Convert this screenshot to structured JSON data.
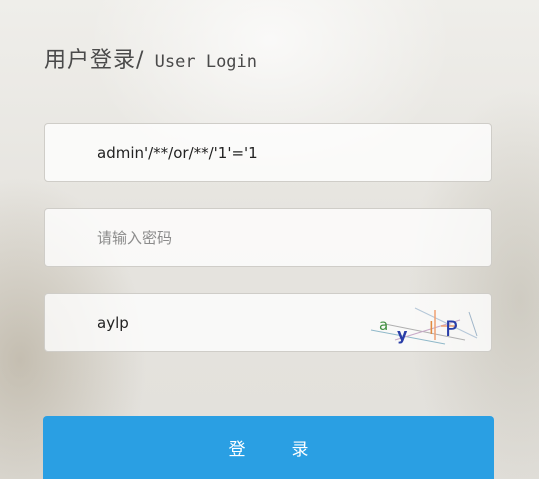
{
  "header": {
    "title_cn": "用户登录/",
    "title_en": " User Login"
  },
  "form": {
    "username_value": "admin'/**/or/**/'1'='1",
    "password_placeholder": "请输入密码",
    "captcha_value": "aylp",
    "captcha_text": "aylP",
    "submit_char_1": "登",
    "submit_char_2": "录"
  },
  "colors": {
    "button": "#2a9fe3",
    "title": "#4a4a4a"
  }
}
